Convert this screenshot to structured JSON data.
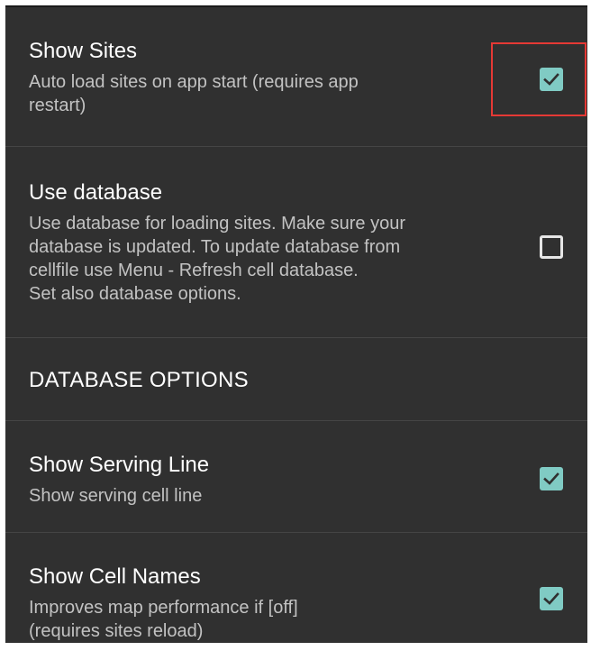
{
  "prefs": {
    "show_sites": {
      "title": "Show Sites",
      "summary_lines": [
        "Auto load sites on app start (requires app",
        "restart)"
      ],
      "checked": true
    },
    "use_database": {
      "title": "Use database",
      "summary_lines": [
        "Use database for loading sites. Make sure your",
        "database is updated. To update database from",
        "cellfile use Menu - Refresh cell database.",
        "Set also database options."
      ],
      "checked": false
    },
    "category": {
      "title": "DATABASE OPTIONS"
    },
    "show_serving_line": {
      "title": "Show Serving Line",
      "summary_lines": [
        "Show serving cell line"
      ],
      "checked": true
    },
    "show_cell_names": {
      "title": "Show Cell Names",
      "summary_lines": [
        "Improves map performance if [off]",
        "(requires sites reload)"
      ],
      "checked": true
    }
  },
  "colors": {
    "background": "#303030",
    "accent": "#80cbc4",
    "highlight": "#e53935"
  }
}
